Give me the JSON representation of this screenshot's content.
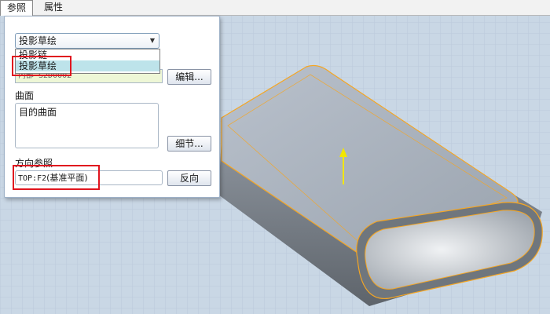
{
  "tabs": [
    {
      "label": "参照",
      "active": true
    },
    {
      "label": "属性",
      "active": false
    }
  ],
  "panel": {
    "type_select": {
      "value": "投影草绘"
    },
    "dropdown_options": [
      {
        "label": "投影链",
        "selected": false
      },
      {
        "label": "投影草绘",
        "selected": true
      }
    ],
    "sketch": {
      "value": "内部 S2D0002",
      "edit_button": "编辑..."
    },
    "surface": {
      "label": "曲面",
      "items": [
        "目的曲面"
      ],
      "details_button": "细节..."
    },
    "direction": {
      "label": "方向参照",
      "value_code": "TOP:F2",
      "value_text": "(基准平面)",
      "flip_button": "反向"
    }
  },
  "colors": {
    "highlight": "#e0141e",
    "edge": "#f5a623",
    "arrow": "#f2e600",
    "background": "#c8d6e4"
  }
}
